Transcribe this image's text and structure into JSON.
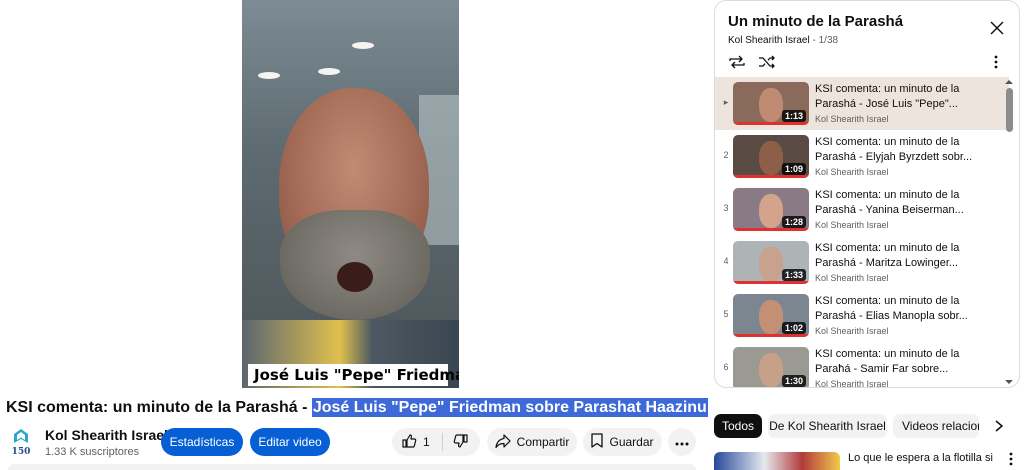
{
  "player": {
    "caption": "José Luis \"Pepe\" Friedman"
  },
  "video": {
    "title_prefix": "KSI comenta: un minuto de la Parashá - ",
    "title_highlighted": "José Luis \"Pepe\" Friedman sobre Parashat Haazinu",
    "channel_name": "Kol Shearith Israel",
    "subscribers": "1.33 K suscriptores",
    "logo_text": "150"
  },
  "actions": {
    "stats_label": "Estadísticas",
    "edit_label": "Editar video",
    "like_count": "1",
    "share_label": "Compartir",
    "save_label": "Guardar"
  },
  "playlist": {
    "title": "Un minuto de la Parashá",
    "channel": "Kol Shearith Israel",
    "position": "1/38",
    "items": [
      {
        "index": "▸",
        "title_line1": "KSI comenta: un minuto de la",
        "title_line2": "Parashá - José Luis \"Pepe\"...",
        "channel": "Kol Shearith Israel",
        "duration": "1:13",
        "thumb_color": "#8a6a5a",
        "face_color": "#c08a73"
      },
      {
        "index": "2",
        "title_line1": "KSI comenta: un minuto de la",
        "title_line2": "Parashá - Elyjah Byrzdett sobr...",
        "channel": "Kol Shearith Israel",
        "duration": "1:09",
        "thumb_color": "#5a4a44",
        "face_color": "#8d5f48"
      },
      {
        "index": "3",
        "title_line1": "KSI comenta: un minuto de la",
        "title_line2": "Parashá - Yanina Beiserman...",
        "channel": "Kol Shearith Israel",
        "duration": "1:28",
        "thumb_color": "#8a7a86",
        "face_color": "#d4a38c"
      },
      {
        "index": "4",
        "title_line1": "KSI comenta: un minuto de la",
        "title_line2": "Parashá - Maritza Lowinger...",
        "channel": "Kol Shearith Israel",
        "duration": "1:33",
        "thumb_color": "#aeb3b6",
        "face_color": "#c9a28e"
      },
      {
        "index": "5",
        "title_line1": "KSI comenta: un minuto de la",
        "title_line2": "Parashá - Elias Manopla sobr...",
        "channel": "Kol Shearith Israel",
        "duration": "1:02",
        "thumb_color": "#7b8690",
        "face_color": "#c49075"
      },
      {
        "index": "6",
        "title_line1": "KSI comenta: un minuto de la",
        "title_line2": "Paraħá - Samir Far sobre...",
        "channel": "Kol Shearith Israel",
        "duration": "1:30",
        "thumb_color": "#9a9a92",
        "face_color": "#c7a08a"
      }
    ]
  },
  "chips": [
    {
      "label": "Todos",
      "active": true
    },
    {
      "label": "De Kol Shearith Israel",
      "active": false
    },
    {
      "label": "Videos relacion",
      "active": false
    }
  ],
  "suggestion": {
    "title": "Lo que le espera a la flotilla si"
  },
  "colors": {
    "accent_blue": "#065fd4",
    "highlight": "#3d6ad6",
    "progress_red": "#e03030",
    "current_row": "#ede4de"
  }
}
